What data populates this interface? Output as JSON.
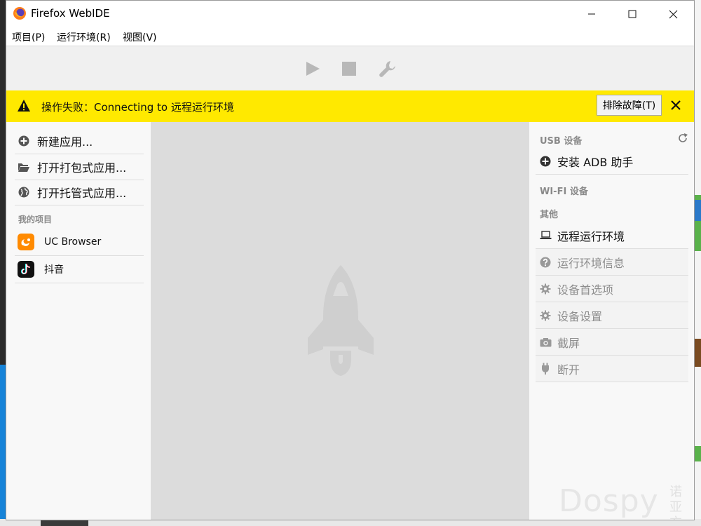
{
  "window": {
    "title": "Firefox WebIDE",
    "controls": [
      "minimize-icon",
      "maximize-icon",
      "close-icon"
    ]
  },
  "menubar": {
    "items": [
      {
        "label": "项目(P)"
      },
      {
        "label": "运行环境(R)"
      },
      {
        "label": "视图(V)"
      }
    ]
  },
  "toolbar": {
    "buttons": [
      "play-icon",
      "stop-icon",
      "wrench-icon"
    ]
  },
  "notification": {
    "text": "操作失败：Connecting to 远程运行环境",
    "troubleshoot_label": "排除故障(T)",
    "icon": "warning-icon",
    "background": "#ffe900"
  },
  "left_panel": {
    "actions": [
      {
        "label": "新建应用...",
        "icon": "plus-circle-icon"
      },
      {
        "label": "打开打包式应用...",
        "icon": "folder-open-icon"
      },
      {
        "label": "打开托管式应用...",
        "icon": "globe-icon"
      }
    ],
    "projects_heading": "我的项目",
    "projects": [
      {
        "label": "UC Browser",
        "icon": "uc-browser-icon",
        "color": "#ff8a00"
      },
      {
        "label": "抖音",
        "icon": "douyin-icon",
        "color": "#111111"
      }
    ]
  },
  "right_panel": {
    "usb_heading": "USB 设备",
    "usb_items": [
      {
        "label": "安装 ADB 助手",
        "icon": "plus-circle-icon"
      }
    ],
    "wifi_heading": "WI-FI 设备",
    "other_heading": "其他",
    "other_items": [
      {
        "label": "远程运行环境",
        "icon": "laptop-icon"
      }
    ],
    "runtime_actions": [
      {
        "label": "运行环境信息",
        "icon": "question-icon"
      },
      {
        "label": "设备首选项",
        "icon": "gear-icon"
      },
      {
        "label": "设备设置",
        "icon": "gear-icon"
      },
      {
        "label": "截屏",
        "icon": "camera-icon"
      },
      {
        "label": "断开",
        "icon": "plug-icon"
      }
    ]
  },
  "watermark": {
    "text": "Dospy",
    "sub": "诺亚方舟"
  }
}
